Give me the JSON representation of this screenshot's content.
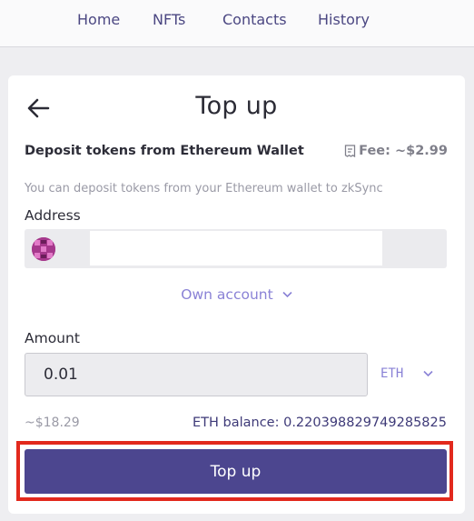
{
  "nav": {
    "items": [
      {
        "label": "Home"
      },
      {
        "label": "NFTs"
      },
      {
        "label": "Contacts"
      },
      {
        "label": "History"
      }
    ]
  },
  "topup": {
    "title": "Top up",
    "subtitle": "Deposit tokens from Ethereum Wallet",
    "fee": "Fee: ~$2.99",
    "description": "You can deposit tokens from your Ethereum wallet to zkSync",
    "address_label": "Address",
    "address_value": "",
    "own_account_label": "Own account",
    "amount_label": "Amount",
    "amount_value": "0.01",
    "token": "ETH",
    "usd_value": "~$18.29",
    "balance": "ETH balance: 0.220398829749285825",
    "button_label": "Top up"
  },
  "colors": {
    "accent": "#4c468f",
    "link": "#8a82d6",
    "highlight": "#e2291d"
  },
  "icons": {
    "back": "arrow-left-icon",
    "fee": "receipt-icon",
    "avatar": "identicon",
    "chevron": "chevron-down-icon"
  }
}
